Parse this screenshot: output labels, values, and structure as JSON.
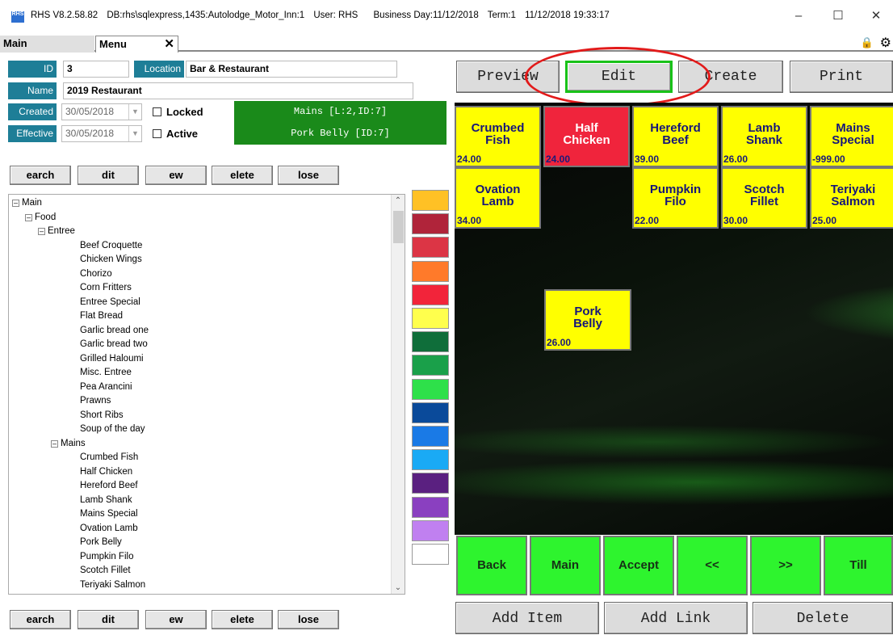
{
  "titlebar": {
    "app": "RHS V8.2.58.82",
    "db": "DB:rhs\\sqlexpress,1435:Autolodge_Motor_Inn:1",
    "user": "User: RHS",
    "business_day": "Business Day:11/12/2018",
    "term": "Term:1",
    "datetime": "11/12/2018 19:33:17",
    "icon_text": "RHS"
  },
  "tabs": {
    "main": "Main",
    "menu": "Menu"
  },
  "form": {
    "id_label": "ID",
    "id_value": "3",
    "location_label": "Location",
    "location_value": "Bar & Restaurant",
    "name_label": "Name",
    "name_value": "2019 Restaurant",
    "created_label": "Created",
    "created_value": "30/05/2018",
    "effective_label": "Effective",
    "effective_value": "30/05/2018",
    "locked_label": "Locked",
    "active_label": "Active",
    "info_line1": "Mains [L:2,ID:7]",
    "info_line2": "Pork Belly [ID:7]"
  },
  "action_buttons": {
    "search": "earch",
    "edit": "dit",
    "new": "ew",
    "delete": "elete",
    "close": "lose"
  },
  "tree": {
    "root": "Main",
    "food": "Food",
    "entree": "Entree",
    "entree_items": [
      "Beef Croquette",
      "Chicken Wings",
      "Chorizo",
      "Corn Fritters",
      "Entree Special",
      "Flat Bread",
      "Garlic bread one",
      "Garlic bread two",
      "Grilled Haloumi",
      "Misc. Entree",
      "Pea Arancini",
      "Prawns",
      "Short Ribs",
      "Soup of the day"
    ],
    "mains": "Mains",
    "mains_items": [
      "Crumbed Fish",
      "Half Chicken",
      "Hereford Beef",
      "Lamb Shank",
      "Mains Special",
      "Ovation Lamb",
      "Pork Belly",
      "Pumpkin Filo",
      "Scotch Fillet",
      "Teriyaki Salmon"
    ]
  },
  "swatch_colors": [
    "#ffc125",
    "#b0243a",
    "#dc3545",
    "#ff7a2a",
    "#f2243a",
    "#ffff4d",
    "#0f6e3a",
    "#1aa04a",
    "#2ee04a",
    "#0a4a9a",
    "#1a7ae6",
    "#1aaaf5",
    "#5a2080",
    "#8a40c0",
    "#c080f0",
    "#ffffff"
  ],
  "top_buttons": {
    "preview": "Preview",
    "edit": "Edit",
    "create": "Create",
    "print": "Print"
  },
  "tiles": {
    "crumbed_fish": {
      "name": "Crumbed Fish",
      "price": "24.00"
    },
    "half_chicken": {
      "name": "Half Chicken",
      "price": "24.00"
    },
    "hereford_beef": {
      "name": "Hereford Beef",
      "price": "39.00"
    },
    "lamb_shank": {
      "name": "Lamb Shank",
      "price": "26.00"
    },
    "mains_special": {
      "name": "Mains Special",
      "price": "-999.00"
    },
    "ovation_lamb": {
      "name": "Ovation Lamb",
      "price": "34.00"
    },
    "pumpkin_filo": {
      "name": "Pumpkin Filo",
      "price": "22.00"
    },
    "scotch_fillet": {
      "name": "Scotch Fillet",
      "price": "30.00"
    },
    "teriyaki_salmon": {
      "name": "Teriyaki Salmon",
      "price": "25.00"
    },
    "pork_belly": {
      "name": "Pork Belly",
      "price": "26.00"
    }
  },
  "nav_buttons": {
    "back": "Back",
    "main": "Main",
    "accept": "Accept",
    "prev": "<<",
    "next": ">>",
    "till": "Till"
  },
  "bottom_buttons": {
    "add_item": "Add Item",
    "add_link": "Add Link",
    "delete": "Delete"
  }
}
